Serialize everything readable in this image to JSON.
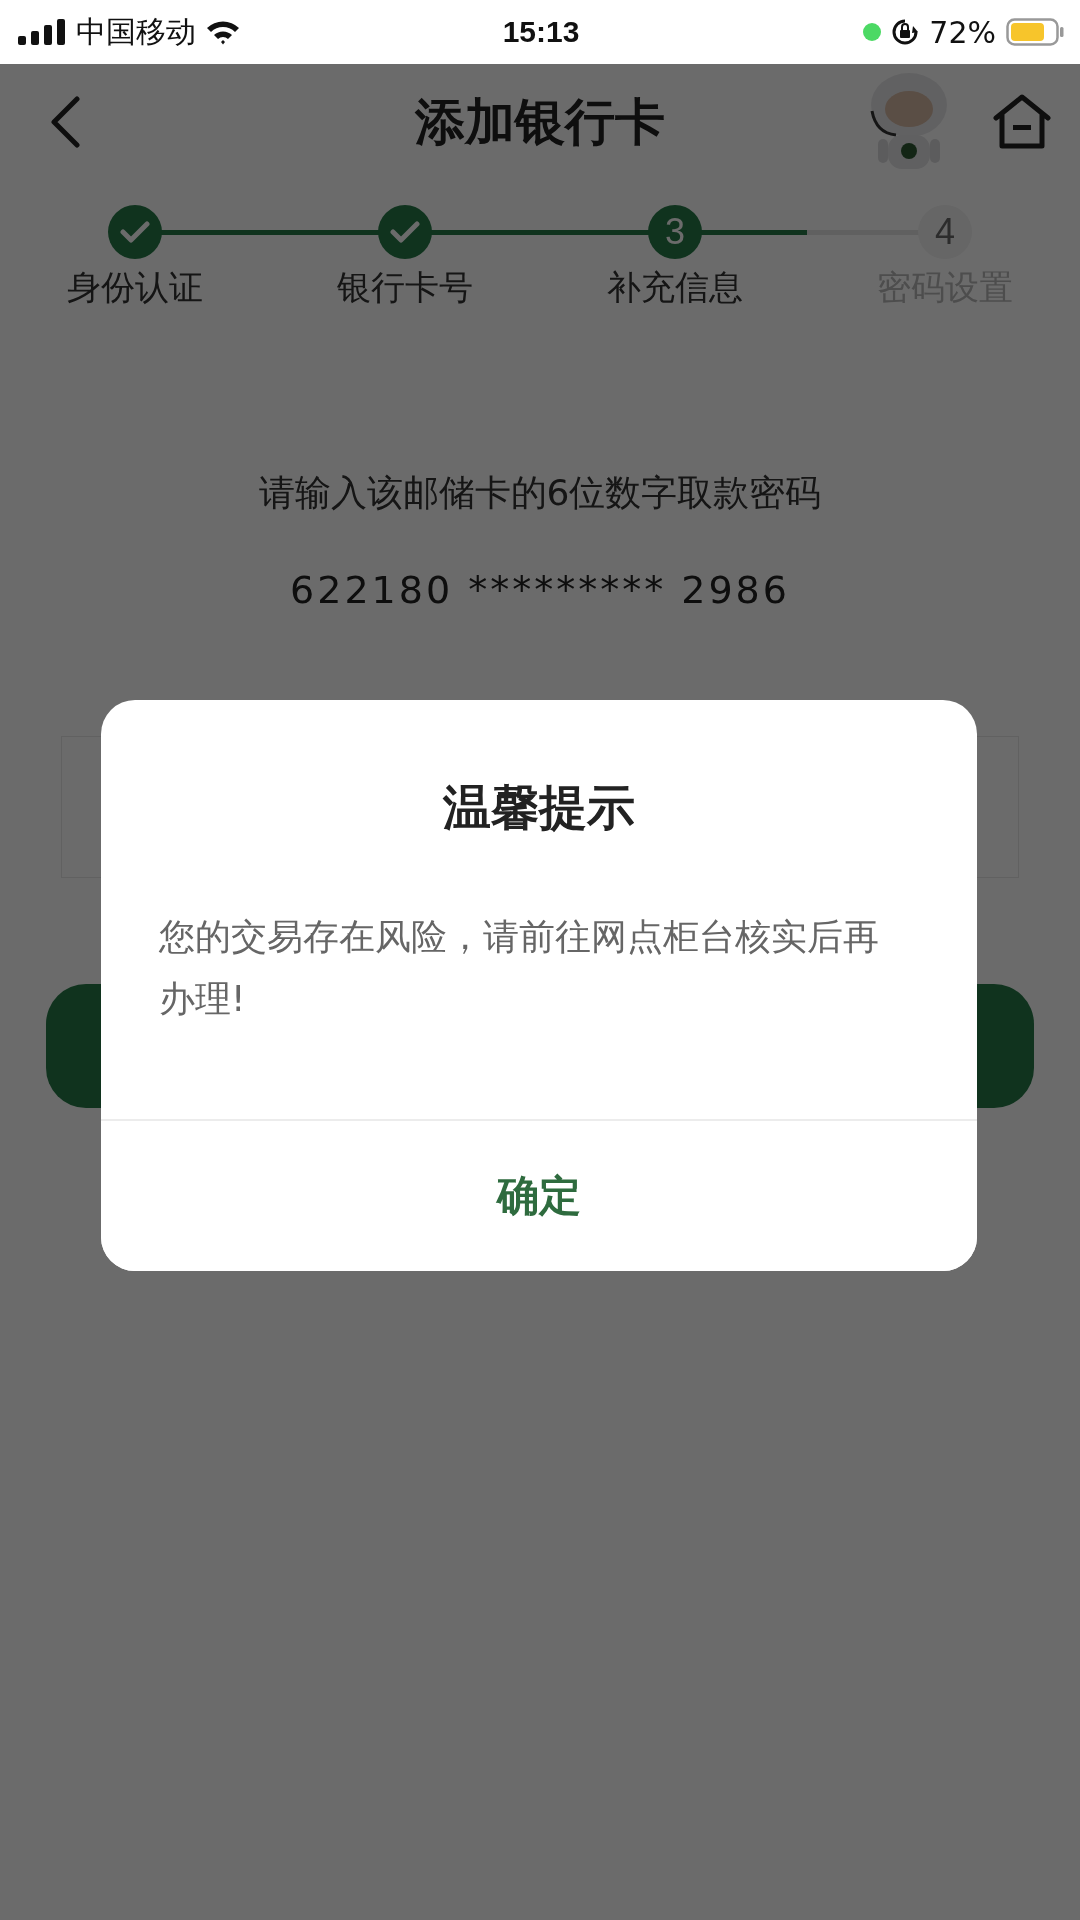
{
  "status_bar": {
    "carrier": "中国移动",
    "time": "15:13",
    "battery": "72%"
  },
  "header": {
    "title": "添加银行卡"
  },
  "steps": [
    {
      "label": "身份认证",
      "done": true,
      "active": true
    },
    {
      "label": "银行卡号",
      "done": true,
      "active": true
    },
    {
      "label": "补充信息",
      "number": "3",
      "done": false,
      "active": true
    },
    {
      "label": "密码设置",
      "number": "4",
      "done": false,
      "active": false
    }
  ],
  "progress": {
    "level": 0.83
  },
  "prompt": "请输入该邮储卡的6位数字取款密码",
  "card_number": "622180 ********* 2986",
  "dialog": {
    "title": "温馨提示",
    "message": "您的交易存在风险，请前往网点柜台核实后再办理!",
    "button": "确定"
  }
}
